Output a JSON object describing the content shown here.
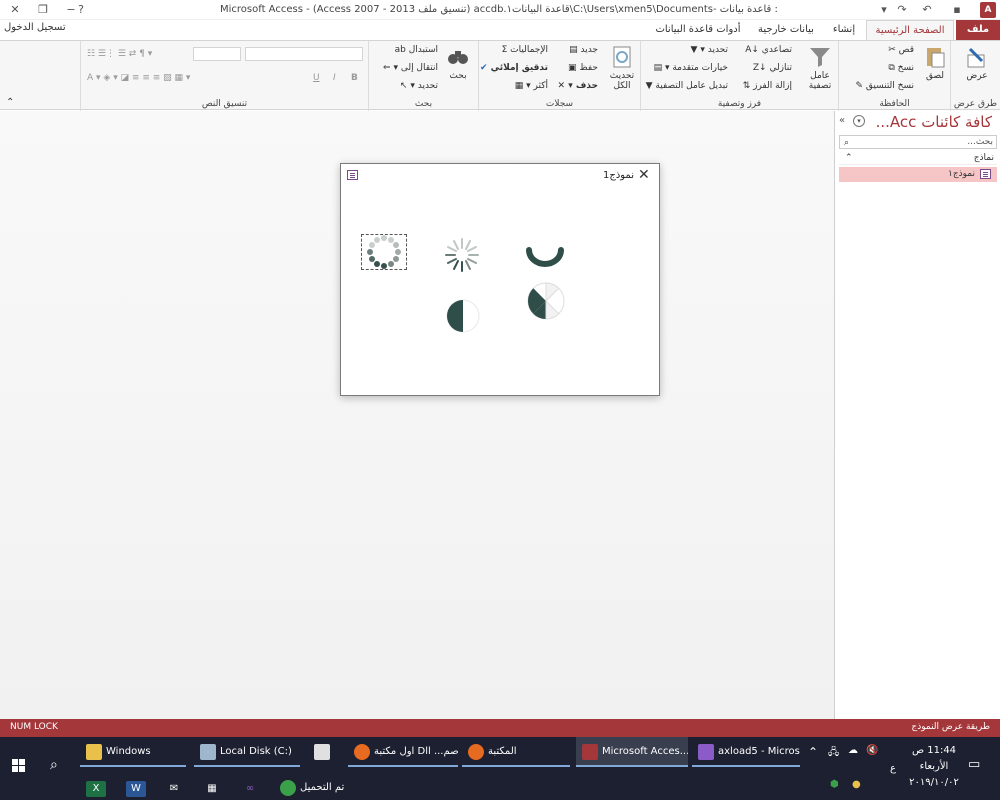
{
  "window": {
    "title": "Microsoft Access - (Access 2007 - 2013 تنسيق ملف) accdb.قاعدة البيانات١\\C:\\Users\\xmen5\\Documents- قاعدة البيانات١ : قاعدة بيانات",
    "sign_in": "تسجيل الدخول",
    "help_icon": "?"
  },
  "tabs": {
    "file": "ملف",
    "home": "الصفحة الرئيسية",
    "create": "إنشاء",
    "external": "بيانات خارجية",
    "dbtools": "أدوات قاعدة البيانات"
  },
  "ribbon": {
    "views": {
      "label": "طرق عرض",
      "view": "عرض"
    },
    "clipboard": {
      "label": "الحافظة",
      "paste": "لصق",
      "cut": "قص",
      "copy": "نسخ",
      "format_painter": "نسخ التنسيق"
    },
    "sort_filter": {
      "label": "فرز وتصفية",
      "filter": "عامل تصفية",
      "ascending": "تصاعدي",
      "descending": "تنازلي",
      "remove_sort": "إزالة الفرز",
      "selection": "تحديد",
      "advanced": "خيارات متقدمة",
      "toggle_filter": "تبديل عامل التصفية"
    },
    "records": {
      "label": "سجلات",
      "refresh": "تحديث الكل",
      "new": "جديد",
      "save": "حفظ",
      "delete": "حذف",
      "totals": "الإجماليات",
      "spelling": "تدقيق إملائي",
      "more": "أكثر"
    },
    "find": {
      "label": "بحث",
      "find": "بحث",
      "replace": "استبدال",
      "goto": "انتقال إلى",
      "select": "تحديد"
    },
    "text_format": {
      "label": "تنسيق النص",
      "bold": "B",
      "italic": "I",
      "underline": "U"
    }
  },
  "nav": {
    "title": "كافة كائنات Acc...",
    "search_placeholder": "بحث...",
    "group": "نماذج",
    "items": [
      "نموذج١"
    ]
  },
  "dialog": {
    "title": "نموذج1",
    "spinners": [
      {
        "name": "dots-ring",
        "color": "#37524e"
      },
      {
        "name": "bars-ring",
        "color": "#37524e"
      },
      {
        "name": "arc",
        "color": "#2f4d49"
      },
      {
        "name": "pie-quarter",
        "color": "#2f4d49"
      },
      {
        "name": "pie-segments",
        "color": "#2f4d49"
      }
    ]
  },
  "statusbar": {
    "left": "NUM LOCK",
    "right": "طريقة عرض النموذج"
  },
  "taskbar": {
    "items": [
      {
        "label": "Windows",
        "icon": "folder-icon",
        "color": "#e8c04a"
      },
      {
        "label": "Local Disk (C:)",
        "icon": "drive-icon",
        "color": "#9fb7cc"
      },
      {
        "label": "",
        "icon": "store-icon",
        "color": "#e0e0e0"
      },
      {
        "label": "اول مكتبة Dll ...اصم",
        "icon": "firefox-icon",
        "color": "#e66a1f"
      },
      {
        "label": "المكتبة",
        "icon": "firefox-icon",
        "color": "#e66a1f"
      },
      {
        "label": "Microsoft Acces...",
        "icon": "access-icon",
        "color": "#a4373a"
      },
      {
        "label": "axload5 - Micros...",
        "icon": "vs-icon",
        "color": "#8b5cc8"
      }
    ],
    "download_label": "تم التحميل",
    "time": "11:44 ص",
    "day": "الأربعاء",
    "date": "٢٠١٩/١٠/٠٢",
    "lang": "ع"
  }
}
